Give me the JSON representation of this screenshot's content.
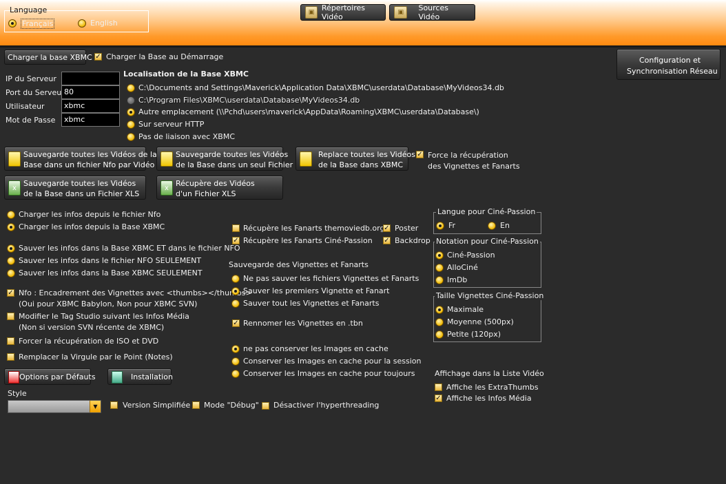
{
  "header": {
    "language_title": "Language",
    "lang_fr": "Français",
    "lang_en": "English",
    "lang_selected": "fr",
    "btn_repertoires": "Répertoires Vidéo",
    "btn_sources": "Sources Vidéo"
  },
  "db": {
    "load_button": "Charger la base XBMC",
    "load_on_start": "Charger la Base au Démarrage",
    "load_on_start_checked": true,
    "config_button_line1": "Configuration et",
    "config_button_line2": "Synchronisation Réseau",
    "server_ip_label": "IP du Serveur",
    "server_ip_value": "",
    "server_port_label": "Port du Serveur",
    "server_port_value": "80",
    "user_label": "Utilisateur",
    "user_value": "xbmc",
    "password_label": "Mot de Passe",
    "password_value": "xbmc",
    "location_title": "Localisation de la Base XBMC",
    "location_options": [
      "C:\\Documents and Settings\\Maverick\\Application Data\\XBMC\\userdata\\Database\\MyVideos34.db",
      "C:\\Program Files\\XBMC\\userdata\\Database\\MyVideos34.db",
      "Autre emplacement (\\\\Pchd\\users\\maverick\\AppData\\Roaming\\XBMC\\userdata\\Database\\)",
      "Sur serveur HTTP",
      "Pas de liaison avec XBMC"
    ],
    "location_selected": 2
  },
  "actions": {
    "save_all_nfo_1": "Sauvegarde toutes les Vidéos de la",
    "save_all_nfo_2": "Base dans un fichier Nfo par Vidéo",
    "save_single_1": "Sauvegarde toutes les Vidéos",
    "save_single_2": "de la Base dans un seul Fichier",
    "replace_1": "Replace toutes les Vidéos",
    "replace_2": "de la Base dans XBMC",
    "force_1": "Force la récupération",
    "force_2": "des Vignettes et Fanarts",
    "force_checked": true,
    "save_xls_1": "Sauvegarde toutes les Vidéos",
    "save_xls_2": "de la Base dans un Fichier XLS",
    "get_xls_1": "Récupère des Vidéos",
    "get_xls_2": "d'un Fichier XLS"
  },
  "options": {
    "load_nfo": "Charger les infos depuis le fichier Nfo",
    "load_db": "Charger les infos depuis la Base XBMC",
    "save_both": "Sauver les infos dans la Base XBMC ET dans le fichier NFO",
    "save_nfo_only": "Sauver les infos dans le fichier NFO SEULEMENT",
    "save_db_only": "Sauver les infos dans la Base XBMC SEULEMENT",
    "nfo_thumbs_1": "Nfo : Encadrement des Vignettes avec <thumbs></thumbs>",
    "nfo_thumbs_2": "(Oui pour XBMC Babylon, Non pour XBMC SVN)",
    "studio_1": "Modifier le Tag Studio suivant les Infos Média",
    "studio_2": "(Non si version SVN récente de XBMC)",
    "force_iso": "Forcer la récupération de ISO et DVD",
    "replace_comma": "Remplacer la Virgule par le Point (Notes)",
    "defaults_button": "Options par Défauts",
    "install_button": "Installation",
    "style_label": "Style",
    "style_value": "",
    "simplified": "Version Simplifiée",
    "debug": "Mode \"Débug\"",
    "hyperthreading": "Désactiver l'hyperthreading"
  },
  "fanarts": {
    "tmdb": "Récupère les Fanarts themoviedb.org",
    "cine": "Récupère les Fanarts Ciné-Passion",
    "poster": "Poster",
    "backdrop": "Backdrop",
    "save_title": "Sauvegarde des Vignettes et Fanarts",
    "no_save": "Ne pas sauver les fichiers Vignettes et Fanarts",
    "save_first": "Sauver les premiers Vignette et Fanart",
    "save_all": "Sauver tout les Vignettes et Fanarts",
    "rename_tbn": "Rennomer les Vignettes en .tbn",
    "cache_none": "ne pas conserver les Images en cache",
    "cache_session": "Conserver les Images en cache pour la session",
    "cache_always": "Conserver les Images en cache pour toujours"
  },
  "cine": {
    "lang_title": "Langue pour Ciné-Passion",
    "lang_fr": "Fr",
    "lang_en": "En",
    "rating_title": "Notation pour Ciné-Passion",
    "rating_cine": "Ciné-Passion",
    "rating_allocine": "AlloCiné",
    "rating_imdb": "ImDb",
    "size_title": "Taille Vignettes Ciné-Passion",
    "size_max": "Maximale",
    "size_mid": "Moyenne (500px)",
    "size_small": "Petite (120px)",
    "display_title": "Affichage dans la Liste Vidéo",
    "extrathumbs": "Affiche les ExtraThumbs",
    "media_info": "Affiche les Infos Média"
  }
}
